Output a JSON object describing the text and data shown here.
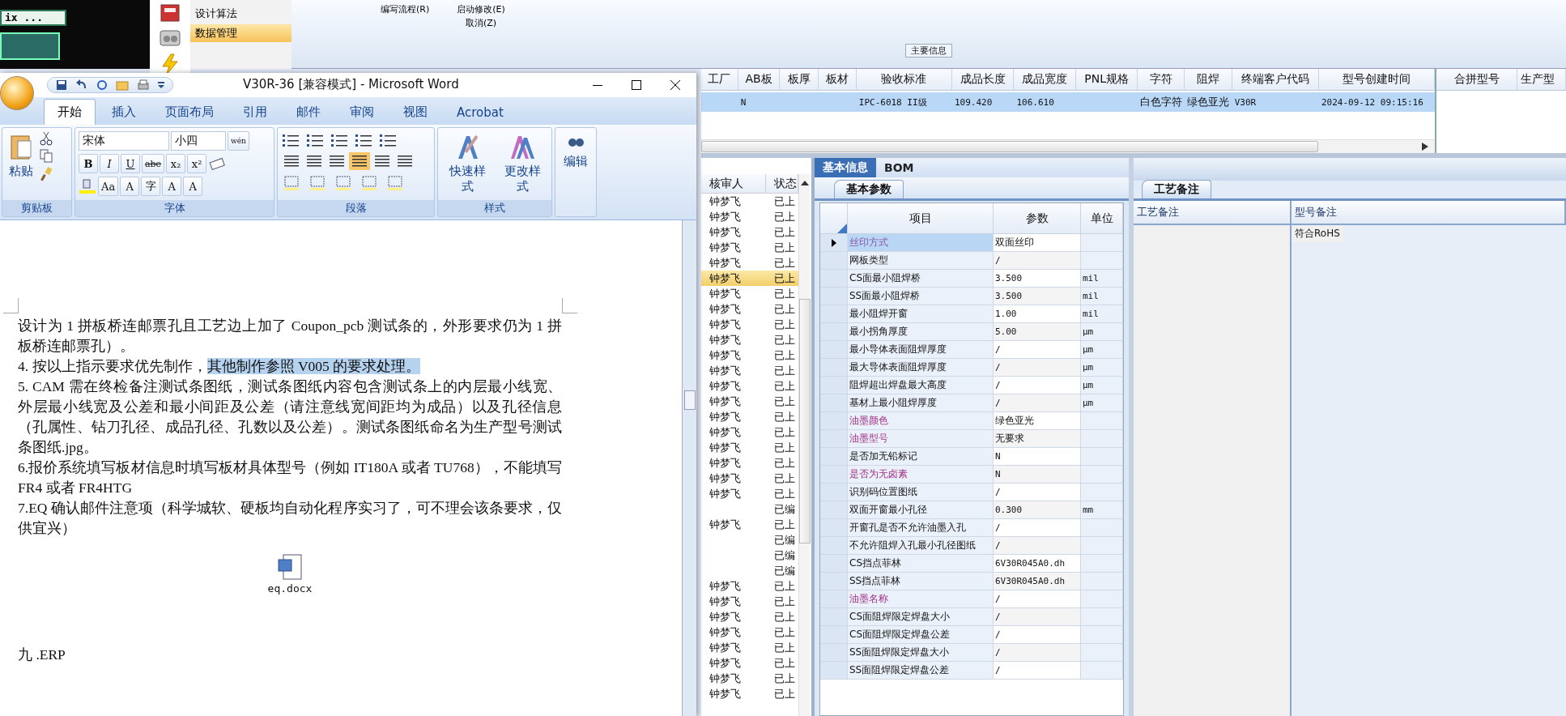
{
  "launcher": {
    "text": "ix ..."
  },
  "nav": {
    "items": [
      {
        "label": "设计算法",
        "selected": false
      },
      {
        "label": "数据管理",
        "selected": true
      }
    ]
  },
  "toolbar": {
    "items": [
      {
        "label": "编写流程(R)"
      },
      {
        "label": "启动修改(E)"
      },
      {
        "label": "取消(Z)"
      }
    ],
    "group_label": "主要信息"
  },
  "main_grid": {
    "columns": [
      "工厂",
      "AB板",
      "板厚",
      "板材",
      "验收标准",
      "成品长度",
      "成品宽度",
      "PNL规格",
      "字符",
      "阻焊",
      "终端客户代码",
      "型号创建时间"
    ],
    "rows": [
      {
        "selected": true,
        "cells": [
          "",
          "N",
          "",
          "",
          "IPC-6018 II级",
          "109.420",
          "106.610",
          "",
          "白色字符",
          "绿色亚光",
          "V30R",
          "2024-09-12 09:15:16"
        ]
      }
    ]
  },
  "merge_grid": {
    "columns": [
      "合拼型号",
      "生产型"
    ]
  },
  "word": {
    "title": "V30R-36 [兼容模式] - Microsoft Word",
    "tabs": [
      {
        "label": "开始",
        "selected": true
      },
      {
        "label": "插入",
        "selected": false
      },
      {
        "label": "页面布局",
        "selected": false
      },
      {
        "label": "引用",
        "selected": false
      },
      {
        "label": "邮件",
        "selected": false
      },
      {
        "label": "审阅",
        "selected": false
      },
      {
        "label": "视图",
        "selected": false
      },
      {
        "label": "Acrobat",
        "selected": false
      }
    ],
    "ribbon": {
      "paste": "粘贴",
      "font_name": "宋体",
      "font_size": "小四",
      "phonetic": "wén",
      "format_row": [
        "B",
        "I",
        "U",
        "abe",
        "x₂",
        "x²"
      ],
      "effect_row": [
        "Aa",
        "A",
        "字",
        "A",
        "A"
      ],
      "quick_style": "快速样式",
      "change_style": "更改样式",
      "edit": "编辑",
      "groups": [
        "剪贴板",
        "字体",
        "段落",
        "样式"
      ]
    },
    "paragraphs": [
      {
        "text": "设计为 1 拼板桥连邮票孔且工艺边上加了 Coupon_pcb 测试条的，外形要求仍为 1 拼板桥连邮票孔）。"
      },
      {
        "text": "4.  按以上指示要求优先制作，",
        "highlight": "其他制作参照 V005 的要求处理。"
      },
      {
        "text": "5.  CAM 需在终检备注测试条图纸，测试条图纸内容包含测试条上的内层最小线宽、外层最小线宽及公差和最小间距及公差（请注意线宽间距均为成品）以及孔径信息（孔属性、钻刀孔径、成品孔径、孔数以及公差）。测试条图纸命名为生产型号测试条图纸.jpg。"
      },
      {
        "text": "6.报价系统填写板材信息时填写板材具体型号（例如 IT180A 或者 TU768），不能填写 FR4 或者 FR4HTG"
      },
      {
        "text": "7.EQ 确认邮件注意项（科学城软、硬板均自动化程序实习了，可不理会该条要求，仅供宜兴）"
      }
    ],
    "attachment": "eq.docx",
    "last_line": "九 .ERP"
  },
  "review_list": {
    "columns": [
      "核审人",
      "状态"
    ],
    "rows": [
      {
        "reviewer": "钟梦飞",
        "status": "已上",
        "selected": false
      },
      {
        "reviewer": "钟梦飞",
        "status": "已上",
        "selected": false
      },
      {
        "reviewer": "钟梦飞",
        "status": "已上",
        "selected": false
      },
      {
        "reviewer": "钟梦飞",
        "status": "已上",
        "selected": false
      },
      {
        "reviewer": "钟梦飞",
        "status": "已上",
        "selected": false
      },
      {
        "reviewer": "钟梦飞",
        "status": "已上",
        "selected": true
      },
      {
        "reviewer": "钟梦飞",
        "status": "已上",
        "selected": false
      },
      {
        "reviewer": "钟梦飞",
        "status": "已上",
        "selected": false
      },
      {
        "reviewer": "钟梦飞",
        "status": "已上",
        "selected": false
      },
      {
        "reviewer": "钟梦飞",
        "status": "已上",
        "selected": false
      },
      {
        "reviewer": "钟梦飞",
        "status": "已上",
        "selected": false
      },
      {
        "reviewer": "钟梦飞",
        "status": "已上",
        "selected": false
      },
      {
        "reviewer": "钟梦飞",
        "status": "已上",
        "selected": false
      },
      {
        "reviewer": "钟梦飞",
        "status": "已上",
        "selected": false
      },
      {
        "reviewer": "钟梦飞",
        "status": "已上",
        "selected": false
      },
      {
        "reviewer": "钟梦飞",
        "status": "已上",
        "selected": false
      },
      {
        "reviewer": "钟梦飞",
        "status": "已上",
        "selected": false
      },
      {
        "reviewer": "钟梦飞",
        "status": "已上",
        "selected": false
      },
      {
        "reviewer": "钟梦飞",
        "status": "已上",
        "selected": false
      },
      {
        "reviewer": "钟梦飞",
        "status": "已上",
        "selected": false
      },
      {
        "reviewer": "",
        "status": "已编",
        "selected": false
      },
      {
        "reviewer": "钟梦飞",
        "status": "已上",
        "selected": false
      },
      {
        "reviewer": "",
        "status": "已编",
        "selected": false
      },
      {
        "reviewer": "",
        "status": "已编",
        "selected": false
      },
      {
        "reviewer": "",
        "status": "已编",
        "selected": false
      },
      {
        "reviewer": "钟梦飞",
        "status": "已上",
        "selected": false
      },
      {
        "reviewer": "钟梦飞",
        "status": "已上",
        "selected": false
      },
      {
        "reviewer": "钟梦飞",
        "status": "已上",
        "selected": false
      },
      {
        "reviewer": "钟梦飞",
        "status": "已上",
        "selected": false
      },
      {
        "reviewer": "钟梦飞",
        "status": "已上",
        "selected": false
      },
      {
        "reviewer": "钟梦飞",
        "status": "已上",
        "selected": false
      },
      {
        "reviewer": "钟梦飞",
        "status": "已上",
        "selected": false
      },
      {
        "reviewer": "钟梦飞",
        "status": "已上",
        "selected": false
      }
    ]
  },
  "detail": {
    "tabs": [
      {
        "label": "基本信息",
        "selected": true
      },
      {
        "label": "BOM",
        "selected": false
      }
    ],
    "subtab": "基本参数",
    "columns": [
      "项目",
      "参数",
      "单位"
    ],
    "rows": [
      {
        "item": "丝印方式",
        "value": "双面丝印",
        "unit": "",
        "emphasized": true,
        "selected": true
      },
      {
        "item": "网板类型",
        "value": "/",
        "unit": "",
        "emphasized": false,
        "selected": false
      },
      {
        "item": "CS面最小阻焊桥",
        "value": "3.500",
        "unit": "mil",
        "emphasized": false,
        "selected": false
      },
      {
        "item": "SS面最小阻焊桥",
        "value": "3.500",
        "unit": "mil",
        "emphasized": false,
        "selected": false
      },
      {
        "item": "最小阻焊开窗",
        "value": "1.00",
        "unit": "mil",
        "emphasized": false,
        "selected": false
      },
      {
        "item": "最小拐角厚度",
        "value": "5.00",
        "unit": "μm",
        "emphasized": false,
        "selected": false
      },
      {
        "item": "最小导体表面阻焊厚度",
        "value": "/",
        "unit": "μm",
        "emphasized": false,
        "selected": false
      },
      {
        "item": "最大导体表面阻焊厚度",
        "value": "/",
        "unit": "μm",
        "emphasized": false,
        "selected": false
      },
      {
        "item": "阻焊超出焊盘最大高度",
        "value": "/",
        "unit": "μm",
        "emphasized": false,
        "selected": false
      },
      {
        "item": "基材上最小阻焊厚度",
        "value": "/",
        "unit": "μm",
        "emphasized": false,
        "selected": false
      },
      {
        "item": "油墨颜色",
        "value": "绿色亚光",
        "unit": "",
        "emphasized": true,
        "selected": false
      },
      {
        "item": "油墨型号",
        "value": "无要求",
        "unit": "",
        "emphasized": true,
        "selected": false
      },
      {
        "item": "是否加无铅标记",
        "value": "N",
        "unit": "",
        "emphasized": false,
        "selected": false
      },
      {
        "item": "是否为无卤素",
        "value": "N",
        "unit": "",
        "emphasized": true,
        "selected": false
      },
      {
        "item": "识别码位置图纸",
        "value": "/",
        "unit": "",
        "emphasized": false,
        "selected": false
      },
      {
        "item": "双面开窗最小孔径",
        "value": "0.300",
        "unit": "mm",
        "emphasized": false,
        "selected": false
      },
      {
        "item": "开窗孔是否不允许油墨入孔",
        "value": "/",
        "unit": "",
        "emphasized": false,
        "selected": false
      },
      {
        "item": "不允许阻焊入孔最小孔径图纸",
        "value": "/",
        "unit": "",
        "emphasized": false,
        "selected": false
      },
      {
        "item": "CS挡点菲林",
        "value": "6V30R045A0.dh",
        "unit": "",
        "emphasized": false,
        "selected": false
      },
      {
        "item": "SS挡点菲林",
        "value": "6V30R045A0.dh",
        "unit": "",
        "emphasized": false,
        "selected": false
      },
      {
        "item": "油墨名称",
        "value": "/",
        "unit": "",
        "emphasized": true,
        "selected": false
      },
      {
        "item": "CS面阻焊限定焊盘大小",
        "value": "/",
        "unit": "",
        "emphasized": false,
        "selected": false
      },
      {
        "item": "CS面阻焊限定焊盘公差",
        "value": "/",
        "unit": "",
        "emphasized": false,
        "selected": false
      },
      {
        "item": "SS面阻焊限定焊盘大小",
        "value": "/",
        "unit": "",
        "emphasized": false,
        "selected": false
      },
      {
        "item": "SS面阻焊限定焊盘公差",
        "value": "/",
        "unit": "",
        "emphasized": false,
        "selected": false
      }
    ]
  },
  "notes": {
    "tab": "工艺备注",
    "columns": [
      "工艺备注",
      "型号备注"
    ],
    "model_note": "符合RoHS"
  }
}
